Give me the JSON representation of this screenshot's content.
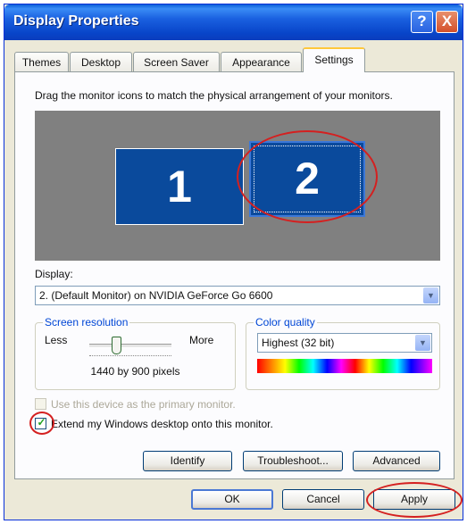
{
  "window": {
    "title": "Display Properties"
  },
  "titlebar": {
    "help_glyph": "?",
    "close_glyph": "X"
  },
  "tabs": [
    {
      "label": "Themes"
    },
    {
      "label": "Desktop"
    },
    {
      "label": "Screen Saver"
    },
    {
      "label": "Appearance"
    },
    {
      "label": "Settings"
    }
  ],
  "active_tab": "Settings",
  "settings": {
    "instruction": "Drag the monitor icons to match the physical arrangement of your monitors.",
    "monitors": [
      "1",
      "2"
    ],
    "display_label": "Display:",
    "display_value": "2. (Default Monitor) on NVIDIA GeForce Go 6600",
    "resolution": {
      "legend": "Screen resolution",
      "less": "Less",
      "more": "More",
      "value": "1440 by 900 pixels",
      "slider_fraction": 0.33
    },
    "color_quality": {
      "legend": "Color quality",
      "value": "Highest (32 bit)"
    },
    "primary_checkbox": {
      "label": "Use this device as the primary monitor.",
      "checked": false,
      "enabled": false
    },
    "extend_checkbox": {
      "label": "Extend my Windows desktop onto this monitor.",
      "checked": true,
      "enabled": true
    },
    "buttons": {
      "identify": "Identify",
      "troubleshoot": "Troubleshoot...",
      "advanced": "Advanced"
    }
  },
  "dialog_buttons": {
    "ok": "OK",
    "cancel": "Cancel",
    "apply": "Apply"
  },
  "colors": {
    "title_bar": "#0a4fd4",
    "monitor_fill": "#0a4a9c",
    "monitor_area": "#808080",
    "highlight_oval": "#d42020",
    "check": "#21a121"
  }
}
